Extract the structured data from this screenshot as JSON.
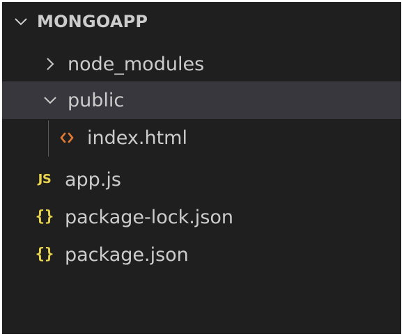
{
  "explorer": {
    "root": {
      "label": "MONGOAPP",
      "expanded": true,
      "chevron": "chevron-down-icon"
    },
    "items": [
      {
        "label": "node_modules",
        "type": "folder",
        "expanded": false,
        "icon": "chevron-right-icon"
      },
      {
        "label": "public",
        "type": "folder",
        "expanded": true,
        "selected": true,
        "icon": "chevron-down-icon"
      },
      {
        "label": "index.html",
        "type": "file",
        "icon": "html-file-icon",
        "icon_glyph": "<>",
        "icon_color": "#e37933"
      },
      {
        "label": "app.js",
        "type": "file",
        "icon": "javascript-file-icon",
        "icon_glyph": "JS",
        "icon_color": "#e8d44d"
      },
      {
        "label": "package-lock.json",
        "type": "file",
        "icon": "json-file-icon",
        "icon_glyph": "{}",
        "icon_color": "#e8d44d"
      },
      {
        "label": "package.json",
        "type": "file",
        "icon": "json-file-icon",
        "icon_glyph": "{}",
        "icon_color": "#e8d44d"
      }
    ]
  },
  "colors": {
    "background": "#1f1f1f",
    "selected_row": "#37373d",
    "text": "#cccccc",
    "html_icon": "#e37933",
    "js_icon": "#e8d44d",
    "json_icon": "#e8d44d"
  }
}
